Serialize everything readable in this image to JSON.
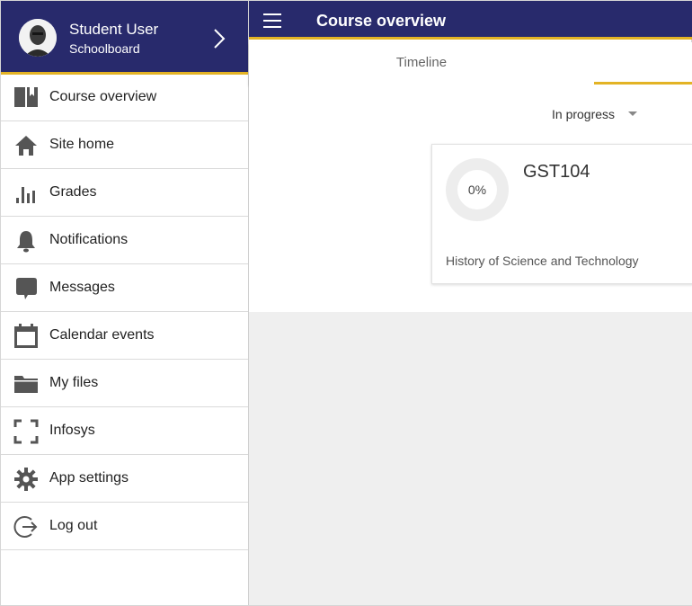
{
  "user": {
    "name": "Student User",
    "site": "Schoolboard"
  },
  "menu": [
    {
      "label": "Course overview",
      "icon": "book-icon"
    },
    {
      "label": "Site home",
      "icon": "home-icon"
    },
    {
      "label": "Grades",
      "icon": "bar-chart-icon"
    },
    {
      "label": "Notifications",
      "icon": "bell-icon"
    },
    {
      "label": "Messages",
      "icon": "chat-bubble-icon"
    },
    {
      "label": "Calendar events",
      "icon": "calendar-icon"
    },
    {
      "label": "My files",
      "icon": "folder-icon"
    },
    {
      "label": "Infosys",
      "icon": "scan-frame-icon"
    },
    {
      "label": "App settings",
      "icon": "gear-icon"
    },
    {
      "label": "Log out",
      "icon": "logout-icon"
    }
  ],
  "header": {
    "title": "Course overview"
  },
  "tabs": {
    "timeline": "Timeline"
  },
  "filter": {
    "selected": "In progress"
  },
  "course": {
    "code": "GST104",
    "name": "History of Science and Technology",
    "progress_label": "0%",
    "progress": 0
  },
  "colors": {
    "primary": "#282a6c",
    "accent": "#e3b325",
    "background": "#efefef"
  }
}
